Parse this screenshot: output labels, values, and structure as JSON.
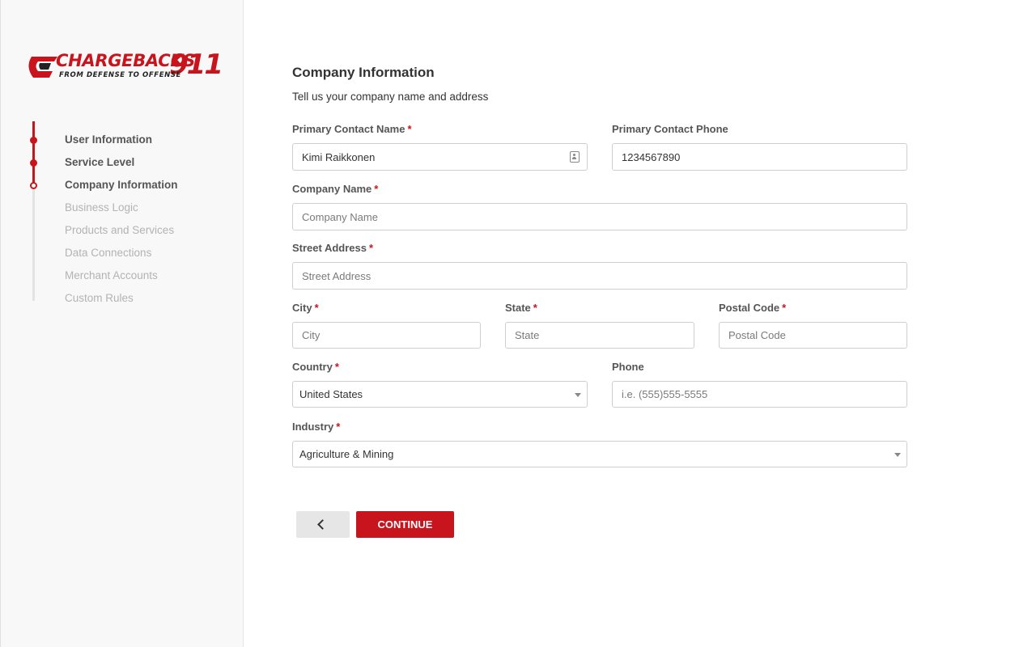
{
  "brand": {
    "logo_main": "CHARGEBACKS",
    "logo_num": "911",
    "logo_tagline": "FROM DEFENSE TO OFFENSE",
    "accent": "#c8141c"
  },
  "steps": [
    {
      "label": "User Information",
      "state": "done"
    },
    {
      "label": "Service Level",
      "state": "done"
    },
    {
      "label": "Company Information",
      "state": "current"
    },
    {
      "label": "Business Logic",
      "state": "pending"
    },
    {
      "label": "Products and Services",
      "state": "pending"
    },
    {
      "label": "Data Connections",
      "state": "pending"
    },
    {
      "label": "Merchant Accounts",
      "state": "pending"
    },
    {
      "label": "Custom Rules",
      "state": "pending"
    }
  ],
  "form": {
    "title": "Company Information",
    "subtitle": "Tell us your company name and address",
    "primary_contact_name": {
      "label": "Primary Contact Name",
      "required": "*",
      "value": "Kimi Raikkonen"
    },
    "primary_contact_phone": {
      "label": "Primary Contact Phone",
      "value": "1234567890"
    },
    "company_name": {
      "label": "Company Name",
      "required": "*",
      "placeholder": "Company Name"
    },
    "street_address": {
      "label": "Street Address",
      "required": "*",
      "placeholder": "Street Address"
    },
    "city": {
      "label": "City",
      "required": "*",
      "placeholder": "City"
    },
    "state": {
      "label": "State",
      "required": "*",
      "placeholder": "State"
    },
    "postal_code": {
      "label": "Postal Code",
      "required": "*",
      "placeholder": "Postal Code"
    },
    "country": {
      "label": "Country",
      "required": "*",
      "value": "United States"
    },
    "phone": {
      "label": "Phone",
      "placeholder": "i.e. (555)555-5555"
    },
    "industry": {
      "label": "Industry",
      "required": "*",
      "value": "Agriculture & Mining"
    }
  },
  "actions": {
    "continue_label": "CONTINUE"
  }
}
